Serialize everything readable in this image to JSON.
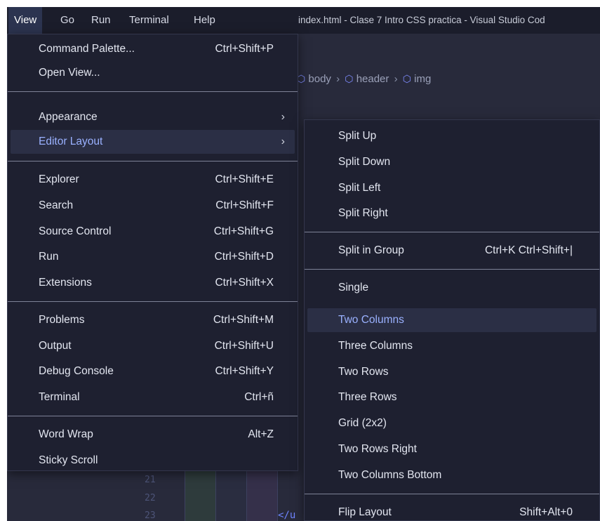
{
  "menubar": {
    "items": [
      {
        "label": "View",
        "active": true
      },
      {
        "label": "Go",
        "active": false
      },
      {
        "label": "Run",
        "active": false
      },
      {
        "label": "Terminal",
        "active": false
      },
      {
        "label": "Help",
        "active": false
      }
    ],
    "window_title": "index.html - Clase 7 Intro CSS practica - Visual Studio Cod"
  },
  "breadcrumb": [
    "body",
    "header",
    "img"
  ],
  "editor": {
    "line_numbers": [
      "21",
      "22",
      "23"
    ],
    "code_fragment": "</u"
  },
  "view_menu": {
    "groups": [
      [
        {
          "label": "Command Palette...",
          "shortcut": "Ctrl+Shift+P"
        },
        {
          "label": "Open View...",
          "shortcut": ""
        }
      ],
      [
        {
          "label": "Appearance",
          "shortcut": "",
          "submenu": true
        },
        {
          "label": "Editor Layout",
          "shortcut": "",
          "submenu": true,
          "highlighted": true
        }
      ],
      [
        {
          "label": "Explorer",
          "shortcut": "Ctrl+Shift+E"
        },
        {
          "label": "Search",
          "shortcut": "Ctrl+Shift+F"
        },
        {
          "label": "Source Control",
          "shortcut": "Ctrl+Shift+G"
        },
        {
          "label": "Run",
          "shortcut": "Ctrl+Shift+D"
        },
        {
          "label": "Extensions",
          "shortcut": "Ctrl+Shift+X"
        }
      ],
      [
        {
          "label": "Problems",
          "shortcut": "Ctrl+Shift+M"
        },
        {
          "label": "Output",
          "shortcut": "Ctrl+Shift+U"
        },
        {
          "label": "Debug Console",
          "shortcut": "Ctrl+Shift+Y"
        },
        {
          "label": "Terminal",
          "shortcut": "Ctrl+ñ"
        }
      ],
      [
        {
          "label": "Word Wrap",
          "shortcut": "Alt+Z"
        },
        {
          "label": "Sticky Scroll",
          "shortcut": ""
        }
      ]
    ]
  },
  "editor_layout_menu": {
    "groups": [
      [
        {
          "label": "Split Up",
          "shortcut": ""
        },
        {
          "label": "Split Down",
          "shortcut": ""
        },
        {
          "label": "Split Left",
          "shortcut": ""
        },
        {
          "label": "Split Right",
          "shortcut": ""
        }
      ],
      [
        {
          "label": "Split in Group",
          "shortcut": "Ctrl+K Ctrl+Shift+|"
        }
      ],
      [
        {
          "label": "Single",
          "shortcut": ""
        },
        {
          "label": "Two Columns",
          "shortcut": "",
          "highlighted": true
        },
        {
          "label": "Three Columns",
          "shortcut": ""
        },
        {
          "label": "Two Rows",
          "shortcut": ""
        },
        {
          "label": "Three Rows",
          "shortcut": ""
        },
        {
          "label": "Grid (2x2)",
          "shortcut": ""
        },
        {
          "label": "Two Rows Right",
          "shortcut": ""
        },
        {
          "label": "Two Columns Bottom",
          "shortcut": ""
        }
      ],
      [
        {
          "label": "Flip Layout",
          "shortcut": "Shift+Alt+0"
        }
      ]
    ]
  },
  "colors": {
    "menu_bg": "#1e2030",
    "highlight_bg": "#2b2f45",
    "highlight_text": "#9ab1ff",
    "separator": "#7e8297"
  }
}
